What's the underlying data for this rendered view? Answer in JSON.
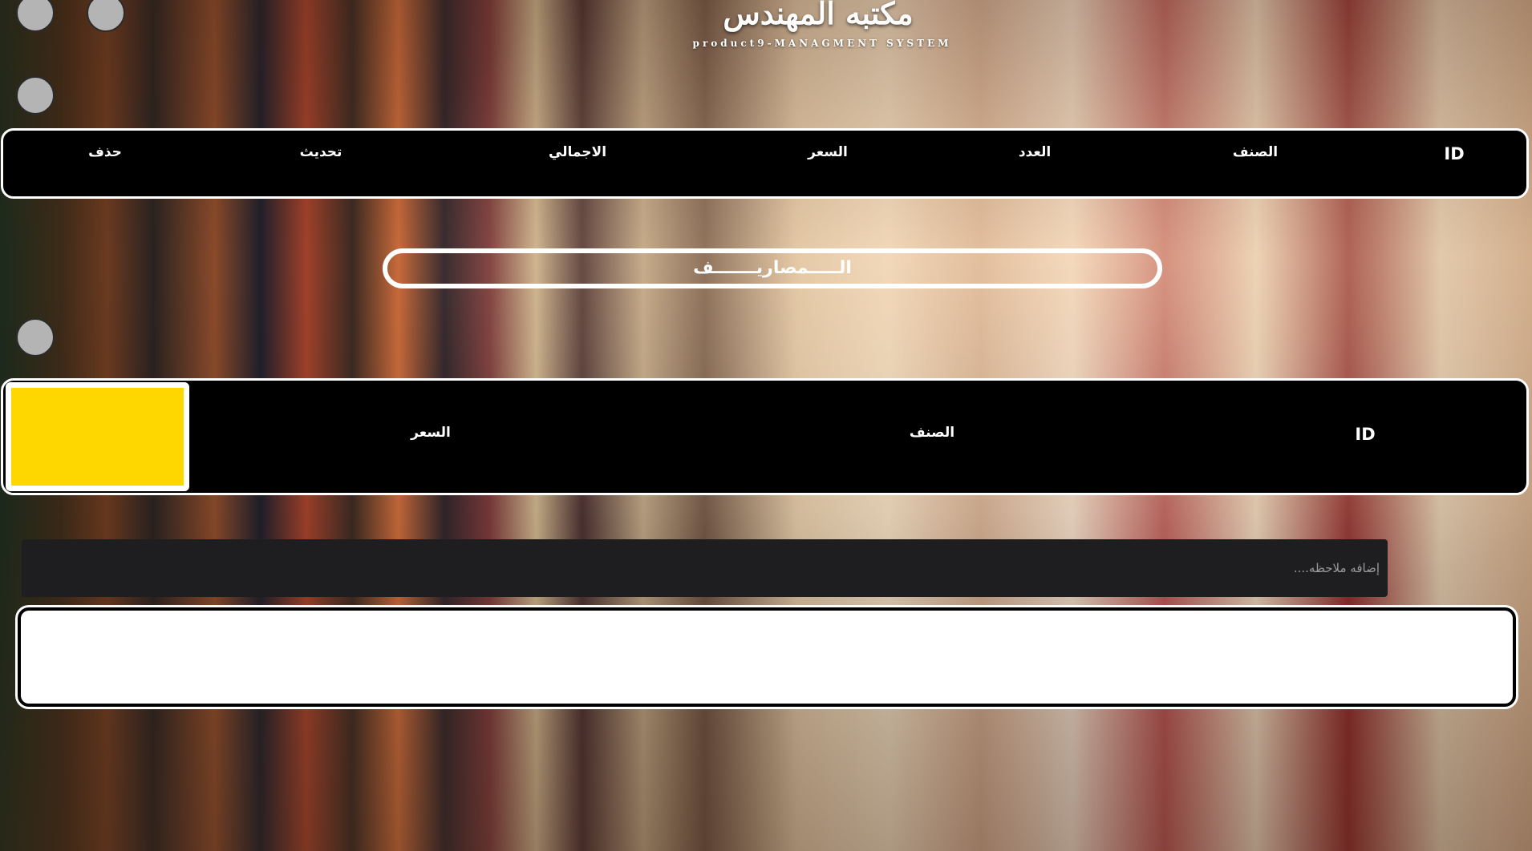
{
  "header": {
    "title": "مكتبه المهندس",
    "subtitle": "product9-MANAGMENT SYSTEM"
  },
  "products_table": {
    "columns": [
      "ID",
      "الصنف",
      "العدد",
      "السعر",
      "الاجمالي",
      "تحديث",
      "حذف"
    ]
  },
  "expenses": {
    "section_title": "الـــــمصاريـــــــف",
    "columns": [
      "ID",
      "الصنف",
      "السعر"
    ],
    "accent_color": "#ffd700"
  },
  "notes": {
    "placeholder": "إضافه ملاحظه...."
  },
  "controls": [
    {
      "icon": "circle-button"
    },
    {
      "icon": "circle-button"
    },
    {
      "icon": "circle-button"
    },
    {
      "icon": "circle-button"
    }
  ]
}
